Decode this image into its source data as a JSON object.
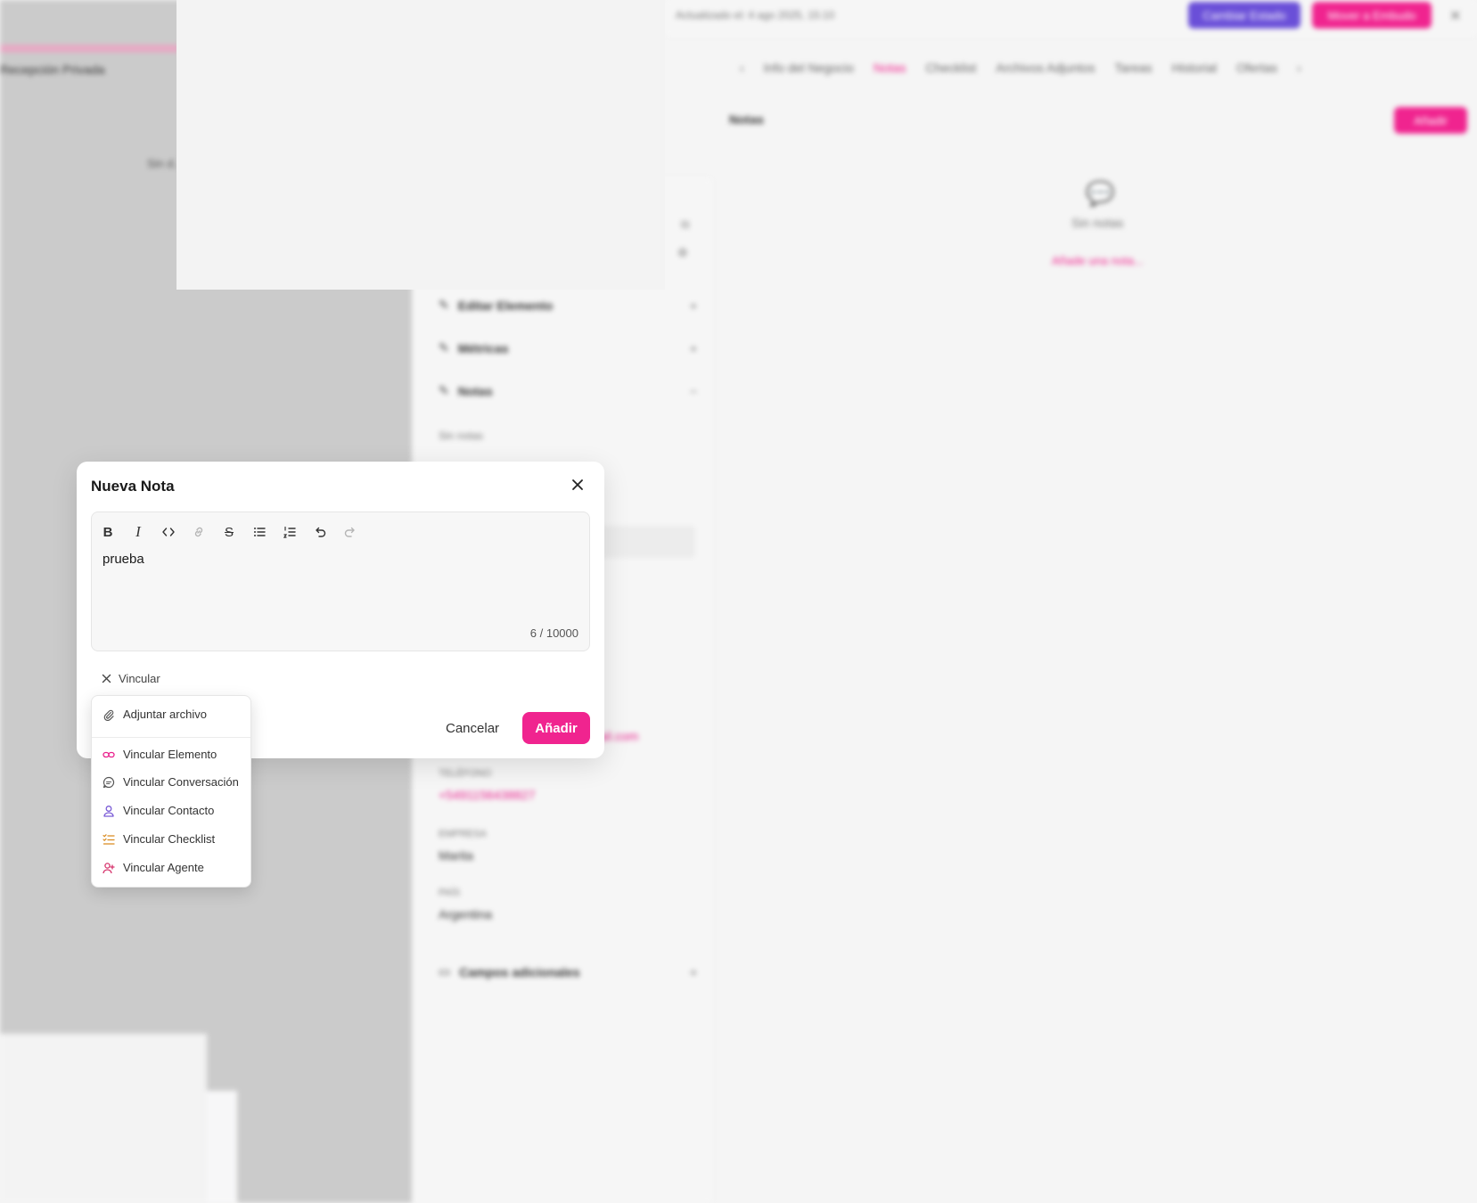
{
  "background": {
    "left_panel_text": "Recepción Privada",
    "left_panel_small": "Sin d...",
    "header_text": "Actualizado el: 4 ago 2025, 15:10",
    "purple_button": "Cambiar Estado",
    "pink_button": "Mover a Embudo",
    "tabs": [
      "Info del Negocio",
      "Notas",
      "Checklist",
      "Archivos Adjuntos",
      "Tareas",
      "Historial",
      "Ofertas"
    ],
    "notes_title": "Notas",
    "notes_add_button": "Añadir",
    "empty_text": "Sin notas",
    "empty_link": "Añade una nota...",
    "side_sections": [
      "Editar Elemento",
      "Métricas",
      "Notas"
    ],
    "side_notes_empty": "Sin notas",
    "fields": [
      {
        "label": "TELÉFONO",
        "value": "+5491156438827"
      },
      {
        "label": "EMPRESA",
        "value": "Marita"
      },
      {
        "label": "PAÍS",
        "value": "Argentina"
      }
    ],
    "email_fragment": "ail.com",
    "extra_section": "Campos adicionales"
  },
  "modal": {
    "title": "Nueva Nota",
    "content": "prueba",
    "char_count": "6 / 10000",
    "vincular_label": "Vincular",
    "cancel_label": "Cancelar",
    "add_label": "Añadir",
    "accent_color": "#f0248f"
  },
  "dropdown": {
    "attach": "Adjuntar archivo",
    "items": [
      {
        "label": "Vincular Elemento",
        "icon": "link-icon",
        "color": "#e91e8c"
      },
      {
        "label": "Vincular Conversación",
        "icon": "chat-icon",
        "color": "#555555"
      },
      {
        "label": "Vincular Contacto",
        "icon": "user-icon",
        "color": "#7b5cd6"
      },
      {
        "label": "Vincular Checklist",
        "icon": "checklist-icon",
        "color": "#d98a1e"
      },
      {
        "label": "Vincular Agente",
        "icon": "user-plus-icon",
        "color": "#d6336c"
      }
    ]
  }
}
